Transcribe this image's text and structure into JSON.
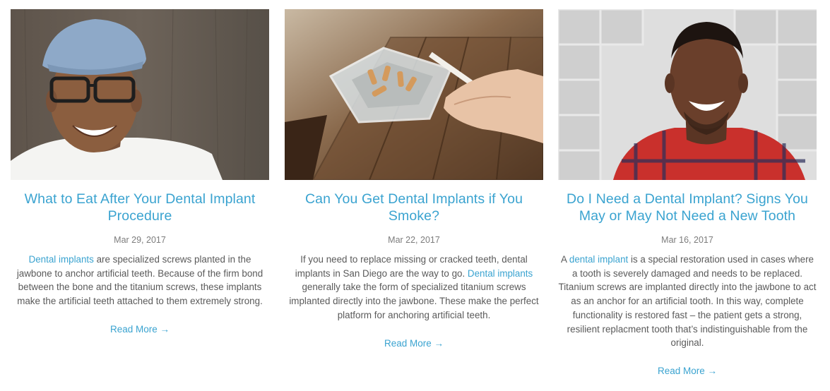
{
  "posts": [
    {
      "image_alt": "Smiling man wearing a flat cap and glasses",
      "title": "What to Eat After Your Dental Implant Procedure",
      "date": "Mar 29, 2017",
      "excerpt_pre": "",
      "excerpt_link": "Dental implants",
      "excerpt_post": " are specialized screws planted in the jawbone to anchor artificial teeth. Because of the firm bond between the bone and the titanium screws, these implants make the artificial teeth attached to them extremely strong.",
      "read_more": "Read More →"
    },
    {
      "image_alt": "Hand tapping a cigarette into a glass ashtray on a wooden table",
      "title": "Can You Get Dental Implants if You Smoke?",
      "date": "Mar 22, 2017",
      "excerpt_pre": "If you need to replace missing or cracked teeth, dental implants in San Diego are the way to go. ",
      "excerpt_link": "Dental implants",
      "excerpt_post": " generally take the form of specialized titanium screws implanted directly into the jawbone. These make the perfect platform for anchoring artificial teeth.",
      "read_more": "Read More →"
    },
    {
      "image_alt": "Smiling man in a red plaid shirt against a tiled wall",
      "title": "Do I Need a Dental Implant? Signs You May or May Not Need a New Tooth",
      "date": "Mar 16, 2017",
      "excerpt_pre": "A ",
      "excerpt_link": "dental implant",
      "excerpt_post": " is a special restoration used in cases where a tooth is severely damaged and needs to be replaced. Titanium screws are implanted directly into the jawbone to act as an anchor for an artificial tooth. In this way, complete functionality is restored fast – the patient gets a strong, resilient replacment tooth that’s indistinguishable from the original.",
      "read_more": "Read More →"
    }
  ],
  "colors": {
    "accent": "#3aa3d0",
    "body_text": "#5a5a5a",
    "date_text": "#7c7c7c"
  }
}
